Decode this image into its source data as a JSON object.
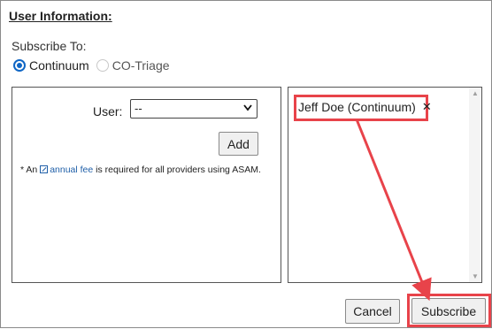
{
  "section_title": "User Information:",
  "subscribe": {
    "label": "Subscribe To:",
    "options": [
      {
        "label": "Continuum",
        "checked": true,
        "enabled": true
      },
      {
        "label": "CO-Triage",
        "checked": false,
        "enabled": false
      }
    ]
  },
  "user_picker": {
    "label": "User:",
    "selected_value": "--",
    "add_label": "Add"
  },
  "fee_note": {
    "prefix": "* An ",
    "link_text": "annual fee",
    "suffix": " is required for all providers using ASAM."
  },
  "selected_users": [
    {
      "name": "Jeff Doe (Continuum)",
      "remove_glyph": "✕"
    }
  ],
  "actions": {
    "cancel_label": "Cancel",
    "subscribe_label": "Subscribe"
  },
  "colors": {
    "annotation": "#e8434a",
    "radio_accent": "#0f66c5",
    "link": "#1f5fa8"
  },
  "icons": {
    "scroll_up": "▲",
    "scroll_down": "▼",
    "select_chevron": "⌄"
  }
}
